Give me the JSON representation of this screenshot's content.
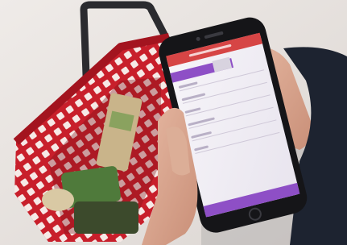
{
  "photo": {
    "subject": "shopping-basket-and-smartphone",
    "colors": {
      "floor": "#e9e5e2",
      "basket_red": "#d0232f",
      "basket_dark": "#8f121b",
      "handle": "#2b2b2f",
      "phone_black": "#151518",
      "screen_bg": "#f3f1f5",
      "app_header_red": "#d64545",
      "app_purple": "#8e4fc6",
      "skin": "#d9a58e",
      "sleeve": "#1d2330"
    },
    "screen": {
      "header_bar": "app-header",
      "highlighted_row": "selected-list-item",
      "footer_bar": "app-footer"
    }
  }
}
